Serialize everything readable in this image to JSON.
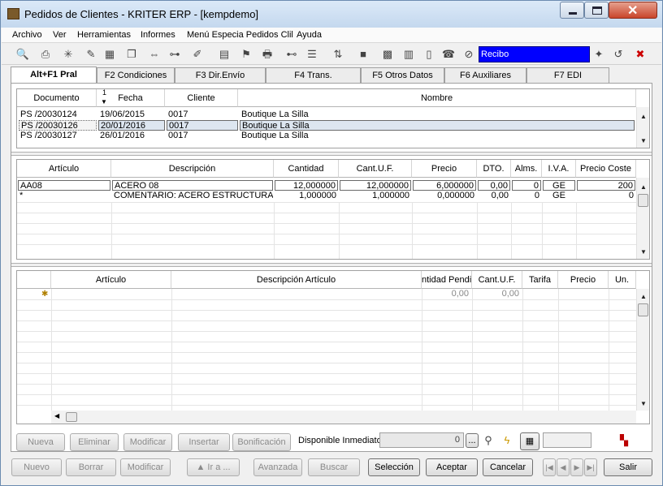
{
  "window": {
    "title": "Pedidos de Clientes - KRITER ERP - [kempdemo]"
  },
  "menu": [
    "Archivo",
    "Ver",
    "Herramientas",
    "Informes",
    "Menú Especia Pedidos Clil",
    "Ayuda"
  ],
  "toolbar": {
    "recibo_value": "Recibo"
  },
  "tabs": [
    "Alt+F1 Pral",
    "F2 Condiciones",
    "F3 Dir.Envío",
    "F4 Trans.",
    "F5 Otros Datos",
    "F6 Auxiliares",
    "F7 EDI"
  ],
  "orders": {
    "columns": [
      "Documento",
      "Fecha",
      "Cliente",
      "Nombre"
    ],
    "sort_indicator": "1",
    "rows": [
      {
        "documento": "PS /20030124",
        "fecha": "19/06/2015",
        "cliente": "0017",
        "nombre": "Boutique La Silla"
      },
      {
        "documento": "PS /20030126",
        "fecha": "20/01/2016",
        "cliente": "0017",
        "nombre": "Boutique La Silla"
      },
      {
        "documento": "PS /20030127",
        "fecha": "26/01/2016",
        "cliente": "0017",
        "nombre": "Boutique La Silla"
      }
    ]
  },
  "lines": {
    "columns": [
      "Artículo",
      "Descripción",
      "Cantidad",
      "Cant.U.F.",
      "Precio",
      "DTO.",
      "Alms.",
      "I.V.A.",
      "Precio Coste"
    ],
    "rows": [
      {
        "articulo": "AA08",
        "descripcion": "ACERO 08",
        "cantidad": "12,000000",
        "cant_uf": "12,000000",
        "precio": "6,000000",
        "dto": "0,00",
        "alms": "0",
        "iva": "GE",
        "precio_coste": "200"
      },
      {
        "articulo": "*",
        "descripcion": "COMENTARIO:  ACERO ESTRUCTURA",
        "cantidad": "1,000000",
        "cant_uf": "1,000000",
        "precio": "0,000000",
        "dto": "0,00",
        "alms": "0",
        "iva": "GE",
        "precio_coste": "0"
      }
    ]
  },
  "pending": {
    "columns": [
      "Artículo",
      "Descripción Artículo",
      "ntidad Pendie",
      "Cant.U.F.",
      "Tarifa",
      "Precio",
      "Un."
    ],
    "new_row_marker": "✱",
    "row": {
      "cantidad_pendiente": "0,00",
      "cant_uf": "0,00"
    }
  },
  "line_buttons": {
    "nueva": "Nueva",
    "eliminar": "Eliminar",
    "modificar": "Modificar",
    "insertar": "Insertar",
    "bonificacion": "Bonificación"
  },
  "disponible": {
    "label": "Disponible Inmediato",
    "value": "0",
    "ellipsis": "..."
  },
  "footer_buttons": {
    "nuevo": "Nuevo",
    "borrar": "Borrar",
    "modificar": "Modificar",
    "ira": "▲ Ir a ...",
    "avanzada": "Avanzada",
    "buscar": "Buscar",
    "seleccion": "Selección",
    "aceptar": "Aceptar",
    "cancelar": "Cancelar",
    "salir": "Salir"
  },
  "nav_glyphs": {
    "first": "|◀",
    "prev": "◀",
    "next": "▶",
    "last": "▶|"
  }
}
